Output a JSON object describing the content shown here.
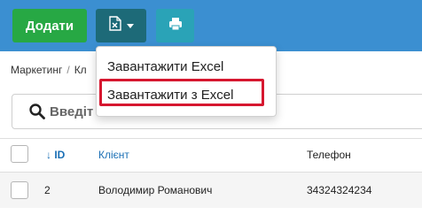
{
  "toolbar": {
    "add_label": "Додати",
    "excel_icon": "excel-file-icon",
    "print_icon": "printer-icon",
    "colors": {
      "bar": "#3b8fd1",
      "add": "#27a844",
      "excel": "#1d6a78",
      "print": "#2aa3b7"
    }
  },
  "dropdown": {
    "items": [
      {
        "label": "Завантажити Excel"
      },
      {
        "label": "Завантажити з Excel"
      }
    ],
    "highlight_color": "#d6172f"
  },
  "breadcrumb": {
    "items": [
      "Маркетинг",
      "Кл"
    ],
    "separator": "/"
  },
  "search": {
    "placeholder": "Введіт",
    "icon": "search-icon"
  },
  "table": {
    "headers": {
      "sort_arrow": "↓",
      "id": "ID",
      "client": "Клієнт",
      "phone": "Телефон"
    },
    "rows": [
      {
        "id": "2",
        "client": "Володимир Романович",
        "phone": "34324324234"
      }
    ]
  }
}
